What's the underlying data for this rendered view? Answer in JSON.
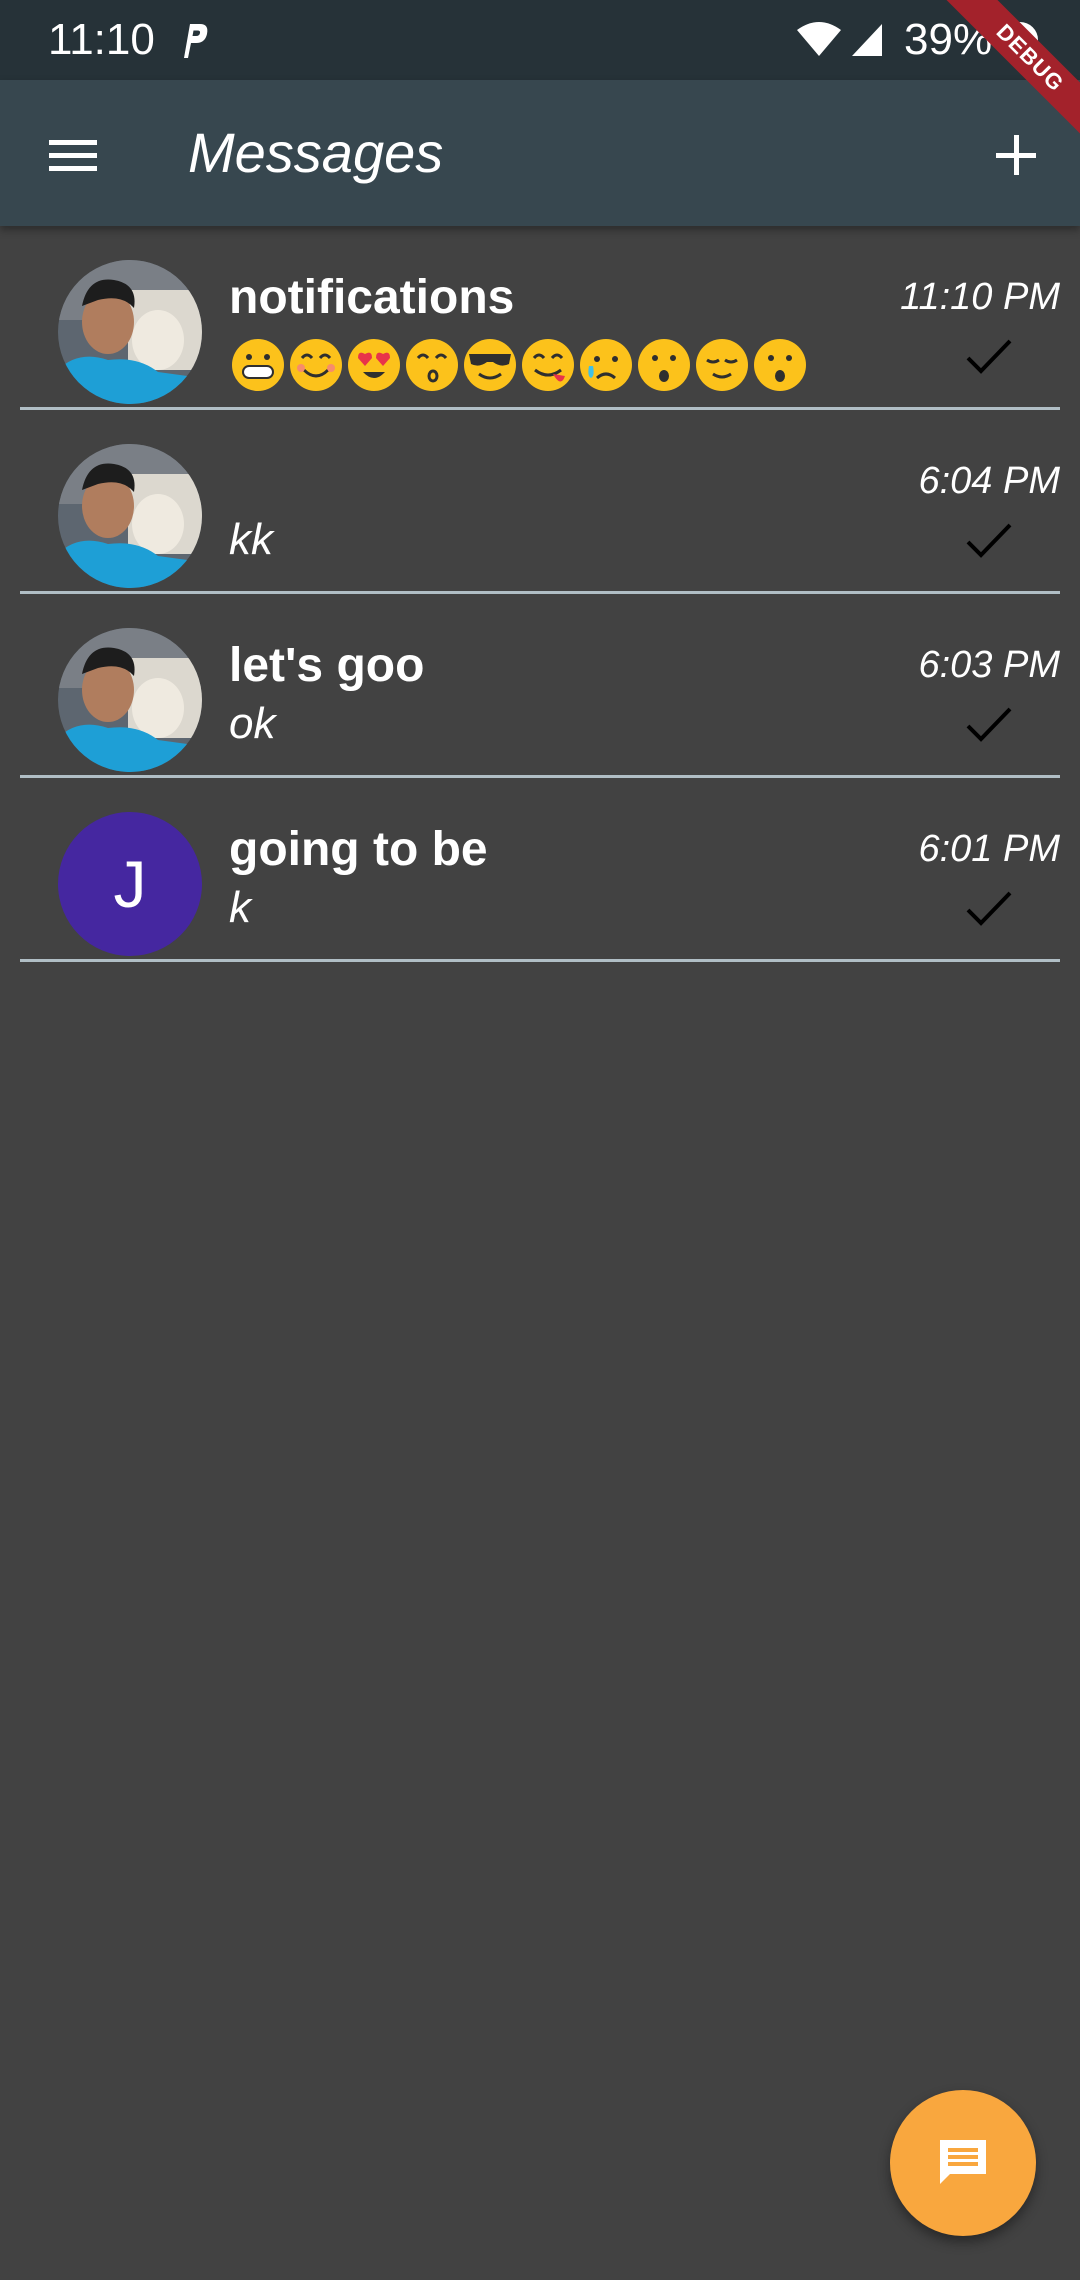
{
  "status_bar": {
    "time": "11:10",
    "battery": "39%"
  },
  "app_bar": {
    "title": "Messages"
  },
  "debug_banner": "DEBUG",
  "conversations": [
    {
      "name": "notifications",
      "preview": "😁😊😍😙😎😋😥😯😌😯",
      "time": "11:10 PM",
      "avatar": "photo"
    },
    {
      "name": "",
      "preview": "kk",
      "time": "6:04 PM",
      "avatar": "photo"
    },
    {
      "name": "let's goo",
      "preview": "ok",
      "time": "6:03 PM",
      "avatar": "photo"
    },
    {
      "name": "going to be",
      "preview": "k",
      "time": "6:01 PM",
      "avatar": "initial",
      "avatar_initial": "J",
      "avatar_color": "#4527a0"
    }
  ],
  "colors": {
    "status_bar": "#263238",
    "app_bar": "#37474f",
    "background": "#424242",
    "divider": "#b0bec5",
    "fab": "#f9a73e"
  },
  "icons": {
    "menu": "menu-icon",
    "add": "add-icon",
    "read": "check-icon",
    "fab": "chat-icon"
  }
}
